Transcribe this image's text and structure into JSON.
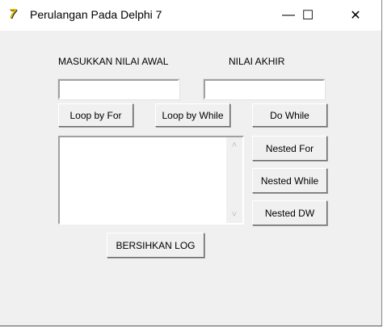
{
  "window": {
    "title": "Perulangan Pada Delphi 7",
    "minimize": "—",
    "maximize": "☐",
    "close": "✕"
  },
  "labels": {
    "start": "MASUKKAN NILAI AWAL",
    "end": "NILAI AKHIR"
  },
  "inputs": {
    "start_value": "",
    "end_value": ""
  },
  "buttons": {
    "loop_for": "Loop by For",
    "loop_while": "Loop by While",
    "do_while": "Do While",
    "nested_for": "Nested For",
    "nested_while": "Nested While",
    "nested_dw": "Nested DW",
    "clear_log": "BERSIHKAN LOG"
  },
  "memo": {
    "content": "",
    "scroll_up": "˄",
    "scroll_down": "˅"
  }
}
